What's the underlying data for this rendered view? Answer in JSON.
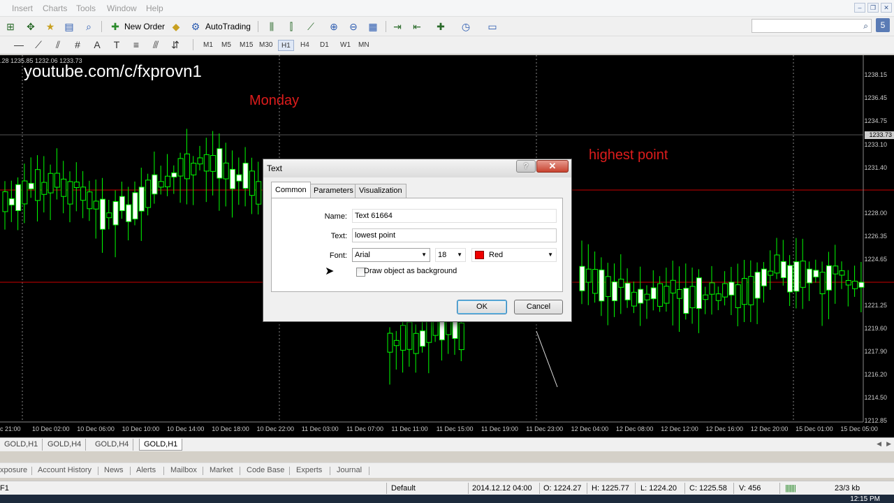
{
  "menubar": {
    "items": [
      "Insert",
      "Charts",
      "Tools",
      "Window",
      "Help"
    ]
  },
  "toolbar": {
    "new_order": "New Order",
    "autotrading": "AutoTrading",
    "timeframes": [
      "M1",
      "M5",
      "M15",
      "M30",
      "H1",
      "H4",
      "D1",
      "W1",
      "MN"
    ],
    "active_timeframe": "H1"
  },
  "chart": {
    "readout": ".28 1235.85 1232.06 1233.73",
    "watermark": "youtube.com/c/fxprovn1",
    "label_monday": "Monday",
    "label_highest": "highest point",
    "price_axis": [
      "1238.15",
      "1236.45",
      "1234.75",
      "1233.10",
      "1231.40",
      "1228.00",
      "1226.35",
      "1224.65",
      "1221.25",
      "1219.60",
      "1217.90",
      "1216.20",
      "1214.50",
      "1212.85"
    ],
    "current_price_tag": "1233.73",
    "time_axis": [
      "c 21:00",
      "10 Dec 02:00",
      "10 Dec 06:00",
      "10 Dec 10:00",
      "10 Dec 14:00",
      "10 Dec 18:00",
      "10 Dec 22:00",
      "11 Dec 03:00",
      "11 Dec 07:00",
      "11 Dec 11:00",
      "11 Dec 15:00",
      "11 Dec 19:00",
      "11 Dec 23:00",
      "12 Dec 04:00",
      "12 Dec 08:00",
      "12 Dec 12:00",
      "12 Dec 16:00",
      "12 Dec 20:00",
      "15 Dec 01:00",
      "15 Dec 05:00"
    ],
    "colors": {
      "bull": "#ffffff",
      "bear": "#00ff00",
      "hline": "#cc0000",
      "background": "#000000"
    }
  },
  "chart_tabs": [
    "GOLD,H1",
    "GOLD,H4",
    "GOLD,H4",
    "GOLD,H1"
  ],
  "active_chart_tab": 3,
  "terminal_tabs": [
    "xposure",
    "Account History",
    "News",
    "Alerts",
    "Mailbox",
    "Market",
    "Code Base",
    "Experts",
    "Journal"
  ],
  "status": {
    "left": "F1",
    "profile": "Default",
    "datetime": "2014.12.12 04:00",
    "open": "O: 1224.27",
    "high": "H: 1225.77",
    "low": "L: 1224.20",
    "close": "C: 1225.58",
    "volume": "V: 456",
    "traffic": "23/3 kb"
  },
  "clock": "12:15 PM",
  "dialog": {
    "title": "Text",
    "help_glyph": "?",
    "close_glyph": "✕",
    "tabs": [
      "Common",
      "Parameters",
      "Visualization"
    ],
    "active_tab": "Common",
    "name_label": "Name:",
    "name_value": "Text 61664",
    "text_label": "Text:",
    "text_value": "lowest point",
    "font_label": "Font:",
    "font_value": "Arial",
    "size_value": "18",
    "color_value": "Red",
    "checkbox_label": "Draw object as background",
    "checkbox_checked": false,
    "ok_label": "OK",
    "cancel_label": "Cancel"
  }
}
